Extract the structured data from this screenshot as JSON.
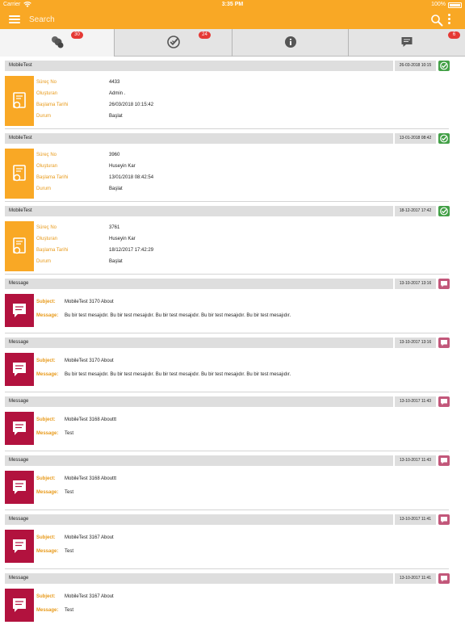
{
  "status_bar": {
    "carrier": "Carrier",
    "time": "3:35 PM",
    "battery": "100%"
  },
  "nav": {
    "search_label": "Search",
    "icons": [
      "menu-icon",
      "search-icon",
      "more-icon"
    ]
  },
  "tabs": [
    {
      "icon": "processes-icon",
      "badge": "30",
      "active": true
    },
    {
      "icon": "approvals-icon",
      "badge": "24",
      "active": false
    },
    {
      "icon": "info-icon",
      "badge": "",
      "active": false
    },
    {
      "icon": "messages-icon",
      "badge": "6",
      "active": false
    }
  ],
  "colors": {
    "accent": "#f9a825",
    "process_icon_bg": "#f9a825",
    "message_icon_bg": "#b2123e",
    "status_green": "#43a047",
    "status_pink": "#c2577a",
    "label_orange": "#e89a1a"
  },
  "process_labels": {
    "id": "Süreç No",
    "creator": "Oluşturan",
    "start": "Başlama Tarihi",
    "state": "Durum"
  },
  "message_labels": {
    "subject": "Subject:",
    "message": "Message:"
  },
  "process_cards": [
    {
      "title": "MobileTest",
      "date": "26-03-2018 10:15",
      "id": "4433",
      "creator": "Admin .",
      "start": "26/03/2018 10:15:42",
      "state": "Başlat"
    },
    {
      "title": "MobileTest",
      "date": "13-01-2018 08:42",
      "id": "3960",
      "creator": "Huseyin Kar",
      "start": "13/01/2018 08:42:54",
      "state": "Başlat"
    },
    {
      "title": "MobileTest",
      "date": "18-12-2017 17:42",
      "id": "3761",
      "creator": "Huseyin Kar",
      "start": "18/12/2017 17:42:29",
      "state": "Başlat"
    }
  ],
  "message_cards": [
    {
      "title": "Message",
      "date": "13-10-2017 13:16",
      "subject": "MobileTest 3170 About",
      "message": "Bu bir test mesajıdır. Bu bir test mesajıdır. Bu bir test mesajıdır. Bu bir test mesajıdır. Bu bir test mesajıdır."
    },
    {
      "title": "Message",
      "date": "13-10-2017 13:16",
      "subject": "MobileTest 3170 About",
      "message": "Bu bir test mesajıdır. Bu bir test mesajıdır. Bu bir test mesajıdır. Bu bir test mesajıdır. Bu bir test mesajıdır."
    },
    {
      "title": "Message",
      "date": "13-10-2017 11:43",
      "subject": "MobileTest 3168 Abouttt",
      "message": "Test"
    },
    {
      "title": "Message",
      "date": "13-10-2017 11:43",
      "subject": "MobileTest 3168 Abouttt",
      "message": "Test"
    },
    {
      "title": "Message",
      "date": "13-10-2017 11:41",
      "subject": "MobileTest 3167 About",
      "message": "Test"
    },
    {
      "title": "Message",
      "date": "13-10-2017 11:41",
      "subject": "MobileTest 3167 About",
      "message": "Test"
    }
  ]
}
